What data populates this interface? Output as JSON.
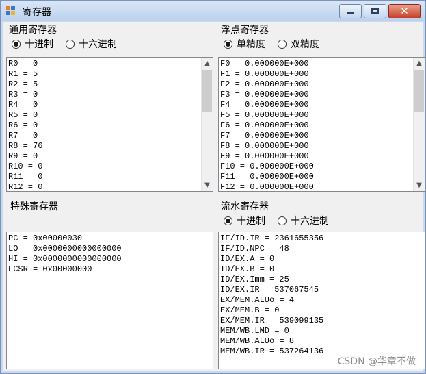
{
  "window": {
    "title": "寄存器"
  },
  "general": {
    "label": "通用寄存器",
    "radio_decimal": "十进制",
    "radio_hex": "十六进制",
    "selected": "decimal",
    "items": [
      "R0 = 0",
      "R1 = 5",
      "R2 = 5",
      "R3 = 0",
      "R4 = 0",
      "R5 = 0",
      "R6 = 0",
      "R7 = 0",
      "R8 = 76",
      "R9 = 0",
      "R10 = 0",
      "R11 = 0",
      "R12 = 0"
    ]
  },
  "float": {
    "label": "浮点寄存器",
    "radio_single": "单精度",
    "radio_double": "双精度",
    "selected": "single",
    "items": [
      "F0 = 0.000000E+000",
      "F1 = 0.000000E+000",
      "F2 = 0.000000E+000",
      "F3 = 0.000000E+000",
      "F4 = 0.000000E+000",
      "F5 = 0.000000E+000",
      "F6 = 0.000000E+000",
      "F7 = 0.000000E+000",
      "F8 = 0.000000E+000",
      "F9 = 0.000000E+000",
      "F10 = 0.000000E+000",
      "F11 = 0.000000E+000",
      "F12 = 0.000000E+000"
    ]
  },
  "special": {
    "label": "特殊寄存器",
    "items": [
      "PC = 0x00000030",
      "LO = 0x0000000000000000",
      "HI = 0x0000000000000000",
      "FCSR = 0x00000000"
    ]
  },
  "pipeline": {
    "label": "流水寄存器",
    "radio_decimal": "十进制",
    "radio_hex": "十六进制",
    "selected": "decimal",
    "items": [
      "IF/ID.IR = 2361655356",
      "IF/ID.NPC = 48",
      "ID/EX.A = 0",
      "ID/EX.B = 0",
      "ID/EX.Imm = 25",
      "ID/EX.IR = 537067545",
      "EX/MEM.ALUo = 4",
      "EX/MEM.B = 0",
      "EX/MEM.IR = 539099135",
      "MEM/WB.LMD = 0",
      "MEM/WB.ALUo = 8",
      "MEM/WB.IR = 537264136"
    ]
  },
  "watermark": "CSDN @华章不做"
}
